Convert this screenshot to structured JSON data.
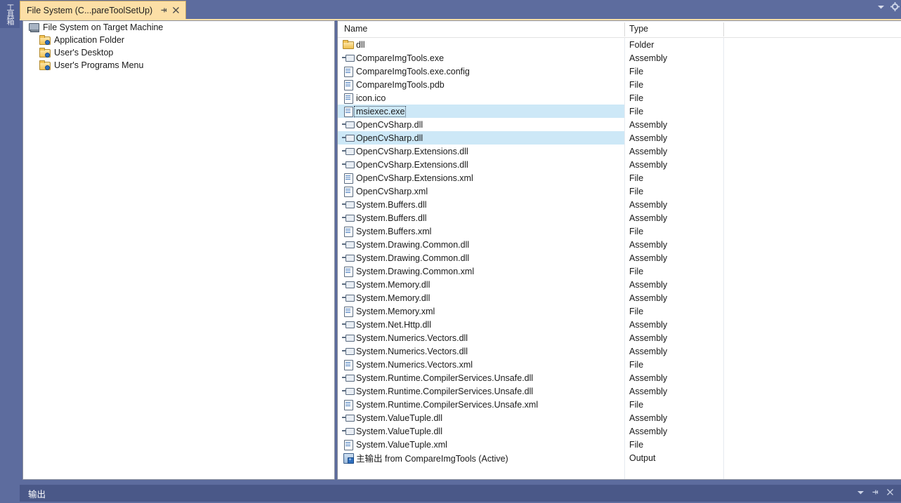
{
  "toolbox": {
    "label": "工具箱"
  },
  "tab": {
    "title": "File System (C...pareToolSetUp)",
    "pin_icon": "pin-icon",
    "close_icon": "close-icon"
  },
  "window_chrome": {
    "dropdown_icon": "chevron-down-icon",
    "settings_icon": "gear-icon"
  },
  "tree": {
    "items": [
      {
        "label": "File System on Target Machine",
        "icon": "computer-icon",
        "indent": false
      },
      {
        "label": "Application Folder",
        "icon": "folder-icon",
        "indent": true
      },
      {
        "label": "User's Desktop",
        "icon": "folder-icon",
        "indent": true
      },
      {
        "label": "User's Programs Menu",
        "icon": "folder-icon",
        "indent": true
      }
    ]
  },
  "list": {
    "columns": [
      "Name",
      "Type"
    ],
    "rows": [
      {
        "name": "dll",
        "type": "Folder",
        "icon": "folder-icon",
        "selected": false,
        "focused": false
      },
      {
        "name": "CompareImgTools.exe",
        "type": "Assembly",
        "icon": "assembly-icon",
        "selected": false,
        "focused": false
      },
      {
        "name": "CompareImgTools.exe.config",
        "type": "File",
        "icon": "document-icon",
        "selected": false,
        "focused": false
      },
      {
        "name": "CompareImgTools.pdb",
        "type": "File",
        "icon": "document-icon",
        "selected": false,
        "focused": false
      },
      {
        "name": "icon.ico",
        "type": "File",
        "icon": "document-icon",
        "selected": false,
        "focused": false
      },
      {
        "name": "msiexec.exe",
        "type": "File",
        "icon": "document-icon",
        "selected": true,
        "focused": true
      },
      {
        "name": "OpenCvSharp.dll",
        "type": "Assembly",
        "icon": "assembly-icon",
        "selected": false,
        "focused": false
      },
      {
        "name": "OpenCvSharp.dll",
        "type": "Assembly",
        "icon": "assembly-icon",
        "selected": true,
        "focused": false
      },
      {
        "name": "OpenCvSharp.Extensions.dll",
        "type": "Assembly",
        "icon": "assembly-icon",
        "selected": false,
        "focused": false
      },
      {
        "name": "OpenCvSharp.Extensions.dll",
        "type": "Assembly",
        "icon": "assembly-icon",
        "selected": false,
        "focused": false
      },
      {
        "name": "OpenCvSharp.Extensions.xml",
        "type": "File",
        "icon": "document-icon",
        "selected": false,
        "focused": false
      },
      {
        "name": "OpenCvSharp.xml",
        "type": "File",
        "icon": "document-icon",
        "selected": false,
        "focused": false
      },
      {
        "name": "System.Buffers.dll",
        "type": "Assembly",
        "icon": "assembly-icon",
        "selected": false,
        "focused": false
      },
      {
        "name": "System.Buffers.dll",
        "type": "Assembly",
        "icon": "assembly-icon",
        "selected": false,
        "focused": false
      },
      {
        "name": "System.Buffers.xml",
        "type": "File",
        "icon": "document-icon",
        "selected": false,
        "focused": false
      },
      {
        "name": "System.Drawing.Common.dll",
        "type": "Assembly",
        "icon": "assembly-icon",
        "selected": false,
        "focused": false
      },
      {
        "name": "System.Drawing.Common.dll",
        "type": "Assembly",
        "icon": "assembly-icon",
        "selected": false,
        "focused": false
      },
      {
        "name": "System.Drawing.Common.xml",
        "type": "File",
        "icon": "document-icon",
        "selected": false,
        "focused": false
      },
      {
        "name": "System.Memory.dll",
        "type": "Assembly",
        "icon": "assembly-icon",
        "selected": false,
        "focused": false
      },
      {
        "name": "System.Memory.dll",
        "type": "Assembly",
        "icon": "assembly-icon",
        "selected": false,
        "focused": false
      },
      {
        "name": "System.Memory.xml",
        "type": "File",
        "icon": "document-icon",
        "selected": false,
        "focused": false
      },
      {
        "name": "System.Net.Http.dll",
        "type": "Assembly",
        "icon": "assembly-icon",
        "selected": false,
        "focused": false
      },
      {
        "name": "System.Numerics.Vectors.dll",
        "type": "Assembly",
        "icon": "assembly-icon",
        "selected": false,
        "focused": false
      },
      {
        "name": "System.Numerics.Vectors.dll",
        "type": "Assembly",
        "icon": "assembly-icon",
        "selected": false,
        "focused": false
      },
      {
        "name": "System.Numerics.Vectors.xml",
        "type": "File",
        "icon": "document-icon",
        "selected": false,
        "focused": false
      },
      {
        "name": "System.Runtime.CompilerServices.Unsafe.dll",
        "type": "Assembly",
        "icon": "assembly-icon",
        "selected": false,
        "focused": false
      },
      {
        "name": "System.Runtime.CompilerServices.Unsafe.dll",
        "type": "Assembly",
        "icon": "assembly-icon",
        "selected": false,
        "focused": false
      },
      {
        "name": "System.Runtime.CompilerServices.Unsafe.xml",
        "type": "File",
        "icon": "document-icon",
        "selected": false,
        "focused": false
      },
      {
        "name": "System.ValueTuple.dll",
        "type": "Assembly",
        "icon": "assembly-icon",
        "selected": false,
        "focused": false
      },
      {
        "name": "System.ValueTuple.dll",
        "type": "Assembly",
        "icon": "assembly-icon",
        "selected": false,
        "focused": false
      },
      {
        "name": "System.ValueTuple.xml",
        "type": "File",
        "icon": "document-icon",
        "selected": false,
        "focused": false
      },
      {
        "name": "主输出 from CompareImgTools (Active)",
        "type": "Output",
        "icon": "output-icon",
        "selected": false,
        "focused": false
      }
    ]
  },
  "output_panel": {
    "title": "输出",
    "dropdown_icon": "chevron-down-icon",
    "pin_icon": "pin-icon",
    "close_icon": "close-icon"
  },
  "colors": {
    "window_background": "#5d6c9e",
    "tab_active": "#fcdfa6",
    "tab_border": "#c8a968",
    "selection": "#cde8f7",
    "panel_background": "#ffffff",
    "output_bar": "#4a5888"
  }
}
